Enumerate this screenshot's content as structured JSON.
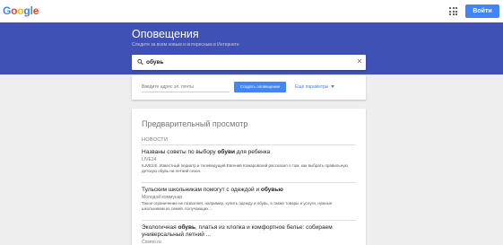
{
  "topbar": {
    "logo_letters": [
      {
        "char": "G",
        "color": "#4285f4"
      },
      {
        "char": "o",
        "color": "#ea4335"
      },
      {
        "char": "o",
        "color": "#fbbc05"
      },
      {
        "char": "g",
        "color": "#4285f4"
      },
      {
        "char": "l",
        "color": "#34a853"
      },
      {
        "char": "e",
        "color": "#ea4335"
      }
    ],
    "apps_icon": "apps-grid-icon",
    "signin_label": "Войти"
  },
  "hero": {
    "title": "Оповещения",
    "subtitle": "Следите за всем новым и интересным в Интернете",
    "background": "#3f51b5"
  },
  "search": {
    "value": "обувь",
    "search_icon": "search-icon",
    "clear_icon": "close-icon"
  },
  "create": {
    "email_placeholder": "Введите адрес эл. почты",
    "create_button": "Создать оповещение",
    "more_params": "Ещё параметры"
  },
  "preview": {
    "title": "Предварительный просмотр",
    "section": "НОВОСТИ",
    "items": [
      {
        "title_parts": [
          "Названы советы по выбору ",
          "обуви",
          " для ребенка"
        ],
        "source": "LIVE24",
        "snippet": "/LIVE24/. Известный педиатр и телеведущий Евгений Комаровский рассказал о том, как выбрать правильную детскую обувь на летний сезон."
      },
      {
        "title_parts": [
          "Тульским школьникам помогут с одеждой и ",
          "обувью",
          ""
        ],
        "source": "Молодой коммунар",
        "snippet": "Такое ограничение не позволяет, например, купить одежду и обувь, а также товары и услуги, нужные школьникам из семей, получающих ..."
      },
      {
        "title_parts": [
          "Экологичная ",
          "обувь",
          ", платья из хлопка и комфортное белье: собираем универсальный летний ..."
        ],
        "source": "Cosmo.ru",
        "snippet": ""
      }
    ]
  }
}
